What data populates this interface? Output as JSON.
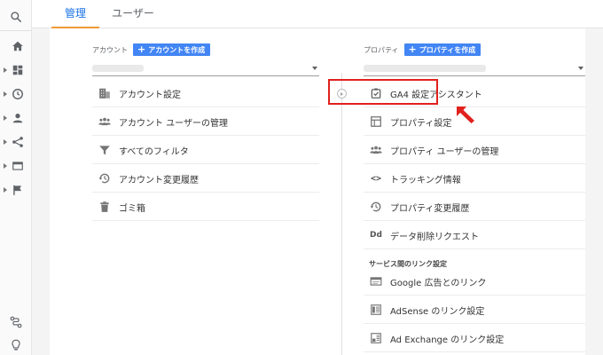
{
  "tabs": [
    {
      "label": "管理",
      "active": true
    },
    {
      "label": "ユーザー",
      "active": false
    }
  ],
  "left_nav": {
    "top": [
      "search-icon"
    ],
    "items": [
      "home-icon",
      "dashboard-icon",
      "clock-icon",
      "person-icon",
      "share-icon",
      "display-icon",
      "flag-icon"
    ],
    "bottom": [
      "route-icon",
      "lightbulb-icon"
    ]
  },
  "account": {
    "label": "アカウント",
    "create_button": "アカウントを作成",
    "items": [
      {
        "label": "アカウント設定",
        "icon": "building-icon"
      },
      {
        "label": "アカウント ユーザーの管理",
        "icon": "people-icon"
      },
      {
        "label": "すべてのフィルタ",
        "icon": "filter-icon"
      },
      {
        "label": "アカウント変更履歴",
        "icon": "history-icon"
      },
      {
        "label": "ゴミ箱",
        "icon": "trash-icon"
      }
    ]
  },
  "property": {
    "label": "プロパティ",
    "create_button": "プロパティを作成",
    "items": [
      {
        "label": "GA4 設定アシスタント",
        "icon": "checkbox-icon",
        "highlighted": true
      },
      {
        "label": "プロパティ設定",
        "icon": "layout-icon"
      },
      {
        "label": "プロパティ ユーザーの管理",
        "icon": "people-icon"
      },
      {
        "label": "トラッキング情報",
        "icon": "code-icon"
      },
      {
        "label": "プロパティ変更履歴",
        "icon": "history-icon"
      },
      {
        "label": "データ削除リクエスト",
        "icon": "dd-icon",
        "glyph": "Dd"
      }
    ],
    "section_title": "サービス間のリンク設定",
    "link_items": [
      {
        "label": "Google 広告とのリンク",
        "icon": "ads-icon"
      },
      {
        "label": "AdSense のリンク設定",
        "icon": "adsense-icon"
      },
      {
        "label": "Ad Exchange のリンク設定",
        "icon": "adexchange-icon"
      }
    ]
  },
  "colors": {
    "accent_blue": "#4285f4",
    "tab_underline": "#f09a36",
    "highlight_red": "#e0211d"
  },
  "code_glyph": "<>"
}
